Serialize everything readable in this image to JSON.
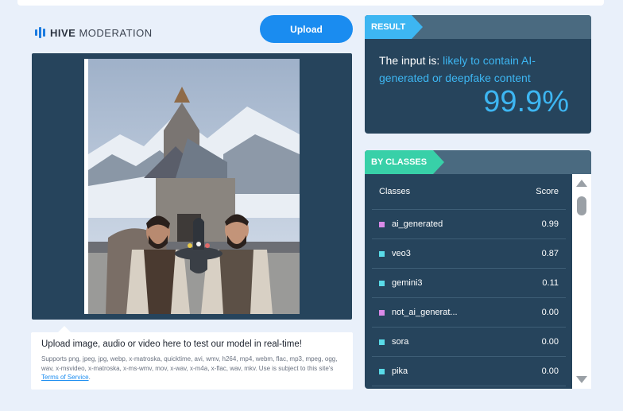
{
  "brand": {
    "name_bold": "HIVE",
    "name_light": "MODERATION"
  },
  "upload_button": {
    "label": "Upload"
  },
  "info": {
    "title": "Upload image, audio or video here to test our model in real-time!",
    "desc": "Supports png, jpeg, jpg, webp, x-matroska, quicktime, avi, wmv, h264, mp4, webm, flac, mp3, mpeg, ogg, wav, x-msvideo, x-matroska, x-ms-wmv, mov, x-wav, x-m4a, x-flac, wav, mkv. Use is subject to this site's ",
    "tos_link": "Terms of Service",
    "tail": "."
  },
  "result": {
    "tag": "RESULT",
    "prefix": "The input is: ",
    "verdict": "likely to contain AI-generated or deepfake content",
    "score": "99.9%"
  },
  "classes": {
    "tag": "BY CLASSES",
    "header_classes": "Classes",
    "header_score": "Score",
    "rows": [
      {
        "name": "ai_generated",
        "score": "0.99",
        "color": "#d98ae8"
      },
      {
        "name": "veo3",
        "score": "0.87",
        "color": "#59dbe8"
      },
      {
        "name": "gemini3",
        "score": "0.11",
        "color": "#59dbe8"
      },
      {
        "name": "not_ai_generat...",
        "score": "0.00",
        "color": "#d98ae8"
      },
      {
        "name": "sora",
        "score": "0.00",
        "color": "#59dbe8"
      },
      {
        "name": "pika",
        "score": "0.00",
        "color": "#59dbe8"
      }
    ]
  },
  "colors": {
    "accent": "#1a8cf0",
    "panel": "#26445c",
    "result_tag": "#3db6f2",
    "classes_tag": "#38d0a8"
  }
}
